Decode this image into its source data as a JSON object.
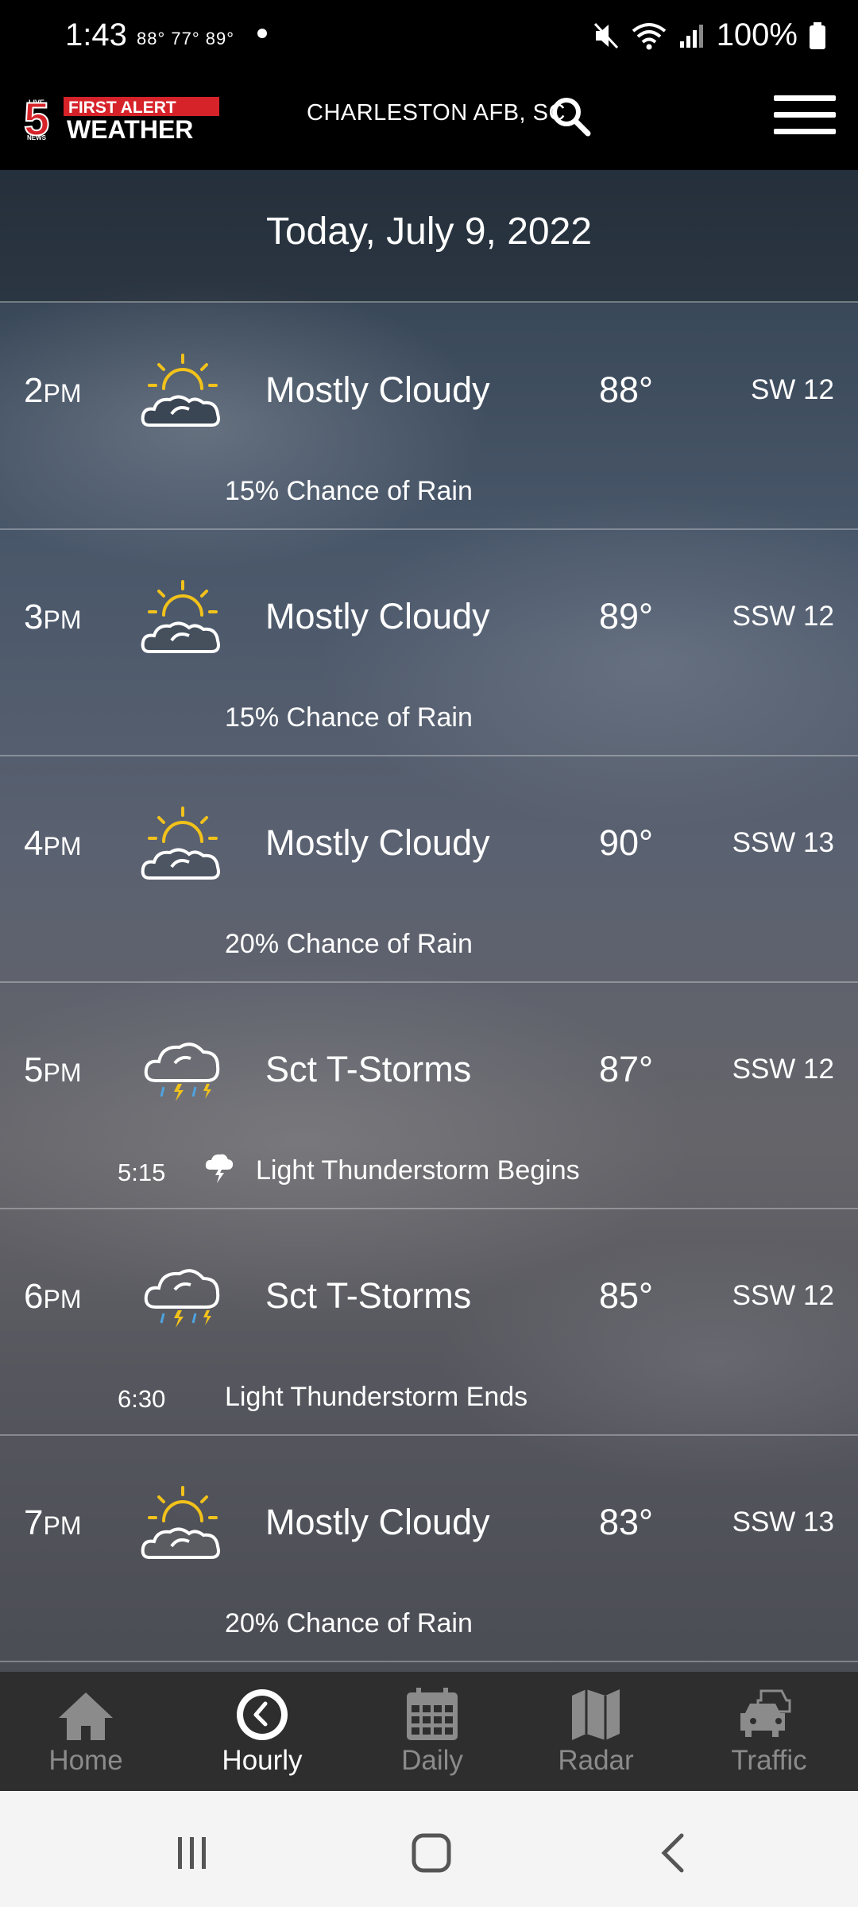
{
  "status_bar": {
    "time": "1:43",
    "temps": "88° 77° 89°",
    "battery": "100%"
  },
  "header": {
    "logo_text": "FIRST ALERT WEATHER",
    "location": "CHARLESTON AFB, SC"
  },
  "date": "Today, July 9, 2022",
  "hours": [
    {
      "hour": "2",
      "ampm": "PM",
      "condition": "Mostly Cloudy",
      "temp": "88°",
      "wind": "SW 12",
      "rain": "15% Chance of Rain",
      "icon": "partly-cloudy-icon"
    },
    {
      "hour": "3",
      "ampm": "PM",
      "condition": "Mostly Cloudy",
      "temp": "89°",
      "wind": "SSW 12",
      "rain": "15% Chance of Rain",
      "icon": "partly-cloudy-icon"
    },
    {
      "hour": "4",
      "ampm": "PM",
      "condition": "Mostly Cloudy",
      "temp": "90°",
      "wind": "SSW 13",
      "rain": "20% Chance of Rain",
      "icon": "partly-cloudy-icon"
    },
    {
      "hour": "5",
      "ampm": "PM",
      "condition": "Sct T-Storms",
      "temp": "87°",
      "wind": "SSW 12",
      "event_time": "5:15",
      "event_text": "Light Thunderstorm Begins",
      "icon": "thunderstorm-icon"
    },
    {
      "hour": "6",
      "ampm": "PM",
      "condition": "Sct T-Storms",
      "temp": "85°",
      "wind": "SSW 12",
      "event_time": "6:30",
      "event_text": "Light Thunderstorm Ends",
      "icon": "thunderstorm-icon"
    },
    {
      "hour": "7",
      "ampm": "PM",
      "condition": "Mostly Cloudy",
      "temp": "83°",
      "wind": "SSW 13",
      "rain": "20% Chance of Rain",
      "icon": "partly-cloudy-icon"
    }
  ],
  "nav": {
    "home": "Home",
    "hourly": "Hourly",
    "daily": "Daily",
    "radar": "Radar",
    "traffic": "Traffic"
  },
  "colors": {
    "sun": "#f2c21b",
    "bolt": "#f2c21b",
    "rain": "#4ea3e0",
    "logo_red": "#d6232a"
  }
}
